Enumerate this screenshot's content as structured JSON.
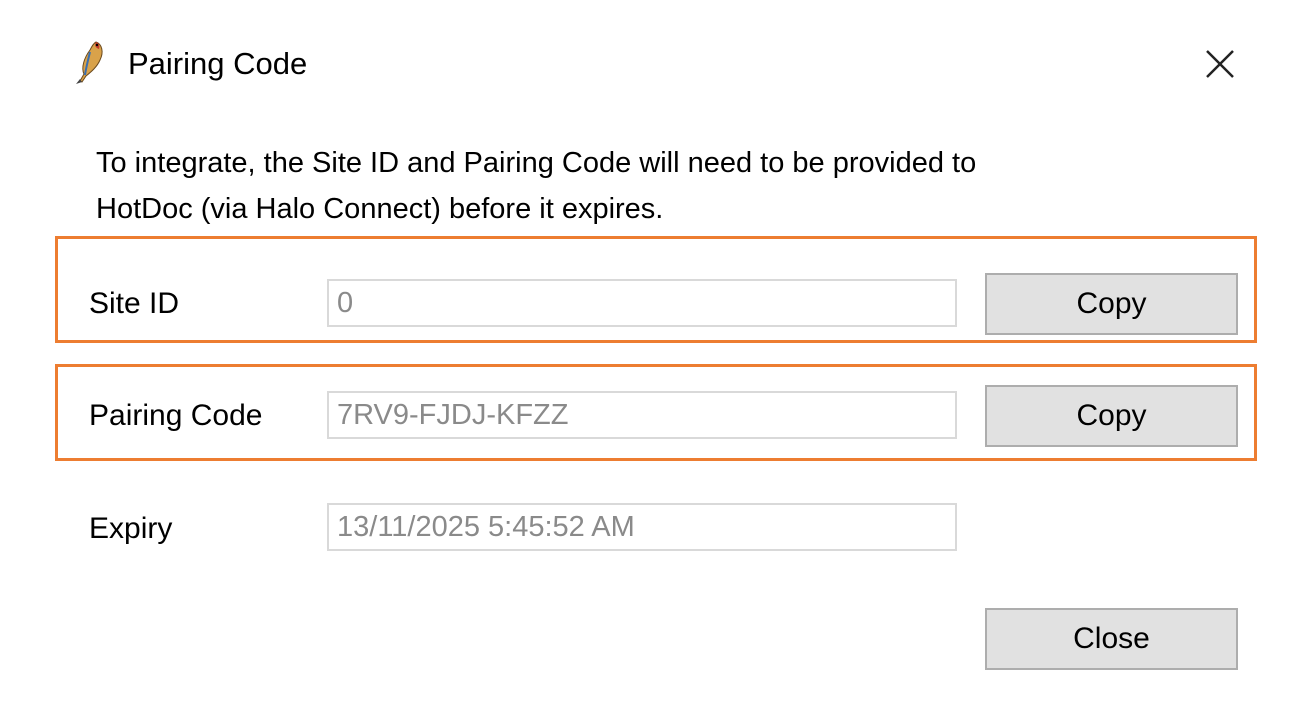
{
  "dialog": {
    "title": "Pairing Code",
    "app_icon": "bird-feather-icon",
    "close_icon": "close-icon"
  },
  "description": {
    "line1": "To integrate, the Site ID and Pairing Code will need to be provided to",
    "line2": "HotDoc (via Halo Connect) before it expires."
  },
  "fields": {
    "site_id": {
      "label": "Site ID",
      "value": "0",
      "button_label": "Copy"
    },
    "pairing_code": {
      "label": "Pairing Code",
      "value": "7RV9-FJDJ-KFZZ",
      "button_label": "Copy"
    },
    "expiry": {
      "label": "Expiry",
      "value": "13/11/2025 5:45:52 AM"
    }
  },
  "footer": {
    "close_label": "Close"
  },
  "colors": {
    "highlight": "#ed7d31",
    "button_bg": "#e1e1e1",
    "field_text": "#8a8a8a"
  }
}
